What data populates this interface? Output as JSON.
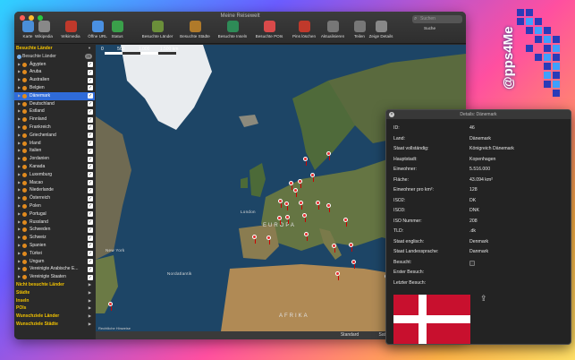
{
  "window": {
    "title": "Meine Reisewelt",
    "toolbar": [
      {
        "label": "Karte",
        "icon": "map-icon"
      },
      {
        "label": "Wikipedia",
        "icon": "wikipedia-icon"
      },
      {
        "label": "Wikimedia",
        "icon": "wikimedia-icon"
      },
      {
        "label": "Öffne URL",
        "icon": "open-url-icon"
      },
      {
        "label": "Status",
        "icon": "status-icon"
      },
      {
        "label": "Besuchte Länder",
        "icon": "visited-countries-icon"
      },
      {
        "label": "Besuchte Städte",
        "icon": "visited-cities-icon"
      },
      {
        "label": "Besuchte Inseln",
        "icon": "visited-islands-icon"
      },
      {
        "label": "Besuchte POIs",
        "icon": "visited-pois-icon"
      },
      {
        "label": "Pins löschen",
        "icon": "delete-pins-icon"
      },
      {
        "label": "Aktualisieren",
        "icon": "refresh-icon"
      },
      {
        "label": "Teilen",
        "icon": "share-icon"
      },
      {
        "label": "Zeige Details",
        "icon": "show-details-icon"
      }
    ],
    "search": {
      "placeholder": "Suchen",
      "label": "Suche"
    }
  },
  "sidebar": {
    "header_visited": "Besuchte Länder",
    "sub_visited": "Besuchte Länder",
    "sub_badge": "25",
    "countries": [
      "Ägypten",
      "Aruba",
      "Australien",
      "Belgien",
      "Dänemark",
      "Deutschland",
      "Estland",
      "Finnland",
      "Frankreich",
      "Griechenland",
      "Irland",
      "Italien",
      "Jordanien",
      "Kanada",
      "Luxemburg",
      "Macao",
      "Niederlande",
      "Österreich",
      "Polen",
      "Portugal",
      "Russland",
      "Schweden",
      "Schweiz",
      "Spanien",
      "Türkei",
      "Ungarn",
      "Vereinigte Arabische E...",
      "Vereinigte Staaten"
    ],
    "selected": "Dänemark",
    "sections": [
      "Nicht besuchte Länder",
      "Städte",
      "Inseln",
      "POIs",
      "Wunschziele Länder",
      "Wunschziele Städte"
    ]
  },
  "map": {
    "scale_labels": [
      "0",
      "500",
      "1.000",
      "1.500 km"
    ],
    "labels": {
      "europa": "EUROPA",
      "afrika": "AFRIKA",
      "atlantik": "Nordatlantik",
      "newyork": "New York",
      "london": "London"
    },
    "attribution": "Rechtliche Hinweise"
  },
  "statusbar": {
    "standard": "Standard",
    "satellite": "Satellit"
  },
  "details": {
    "title": "Details: Dänemark",
    "rows": [
      {
        "k": "ID:",
        "v": "46"
      },
      {
        "k": "Land:",
        "v": "Dänemark"
      },
      {
        "k": "Staat vollständig:",
        "v": "Königreich Dänemark"
      },
      {
        "k": "Hauptstadt:",
        "v": "Kopenhagen"
      },
      {
        "k": "Einwohner:",
        "v": "5.516.000"
      },
      {
        "k": "Fläche:",
        "v": "43.094 km²"
      },
      {
        "k": "Einwohner pro km²:",
        "v": "128"
      },
      {
        "k": "ISO2:",
        "v": "DK"
      },
      {
        "k": "ISO3:",
        "v": "DNK"
      },
      {
        "k": "ISO Nummer:",
        "v": "208"
      },
      {
        "k": "TLD:",
        "v": ".dk"
      },
      {
        "k": "Staat englisch:",
        "v": "Denmark"
      },
      {
        "k": "Staat Landessprache:",
        "v": "Danmark"
      },
      {
        "k": "Besucht:",
        "v": ""
      },
      {
        "k": "Erster Besuch:",
        "v": ""
      },
      {
        "k": "Letzter Besuch:",
        "v": ""
      }
    ]
  },
  "branding": {
    "text": "@pps4Me"
  },
  "colors": {
    "accent": "#2f6bd9",
    "section": "#f2c200",
    "pin": "#e53030",
    "flag_red": "#c8102e"
  }
}
